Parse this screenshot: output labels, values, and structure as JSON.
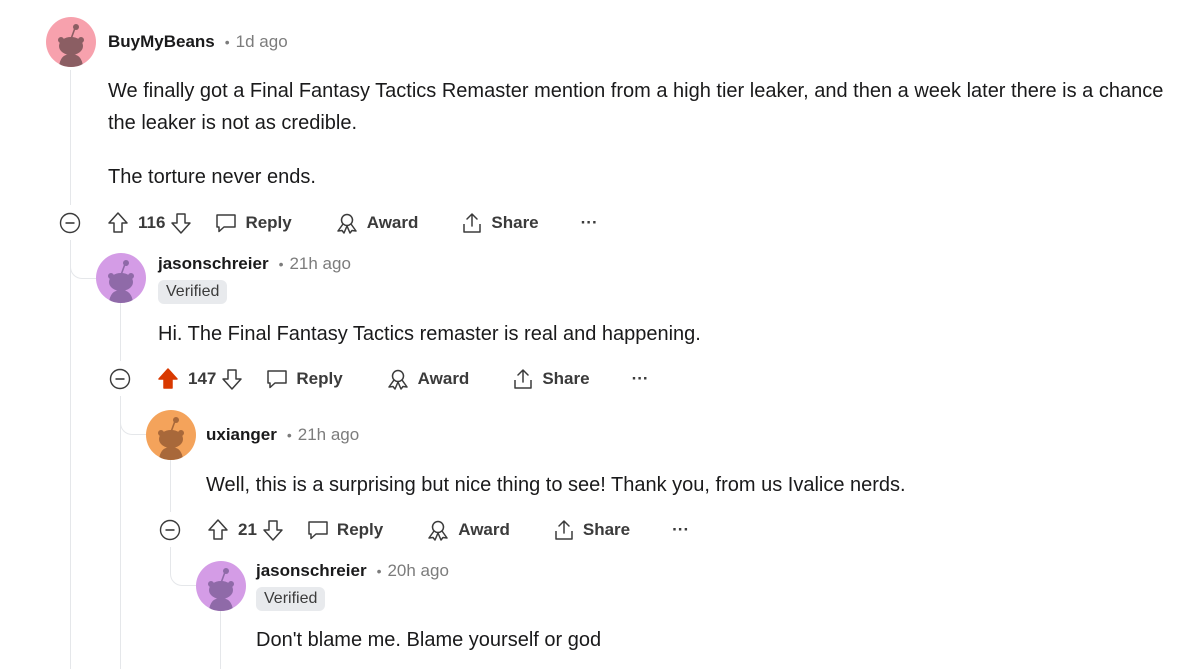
{
  "comments": [
    {
      "author": "BuyMyBeans",
      "separator": "•",
      "age": "1d ago",
      "avatar_color": "#f7a1ad",
      "paragraphs": [
        "We finally got a Final Fantasy Tactics Remaster mention from a high tier leaker, and then a week later there is a chance the leaker is not as credible.",
        "The torture never ends."
      ],
      "score": "116",
      "upvoted": false,
      "actions": {
        "reply": "Reply",
        "award": "Award",
        "share": "Share",
        "more": "···"
      }
    },
    {
      "author": "jasonschreier",
      "separator": "•",
      "age": "21h ago",
      "badge": "Verified",
      "avatar_color": "#d49ce6",
      "paragraphs": [
        "Hi. The Final Fantasy Tactics remaster is real and happening."
      ],
      "score": "147",
      "upvoted": true,
      "actions": {
        "reply": "Reply",
        "award": "Award",
        "share": "Share",
        "more": "···"
      }
    },
    {
      "author": "uxianger",
      "separator": "•",
      "age": "21h ago",
      "avatar_color": "#f4a35b",
      "paragraphs": [
        "Well, this is a surprising but nice thing to see! Thank you, from us Ivalice nerds."
      ],
      "score": "21",
      "upvoted": false,
      "actions": {
        "reply": "Reply",
        "award": "Award",
        "share": "Share",
        "more": "···"
      }
    },
    {
      "author": "jasonschreier",
      "separator": "•",
      "age": "20h ago",
      "badge": "Verified",
      "avatar_color": "#d49ce6",
      "paragraphs": [
        "Don't blame me. Blame yourself or god"
      ]
    }
  ],
  "colors": {
    "upvote_active": "#d93900",
    "thread_line": "#e5e7ea",
    "meta_text": "#7c7c7c"
  },
  "icons": [
    "snoo-avatar-icon",
    "collapse-icon",
    "upvote-icon",
    "downvote-icon",
    "reply-icon",
    "award-icon",
    "share-icon",
    "more-icon"
  ]
}
